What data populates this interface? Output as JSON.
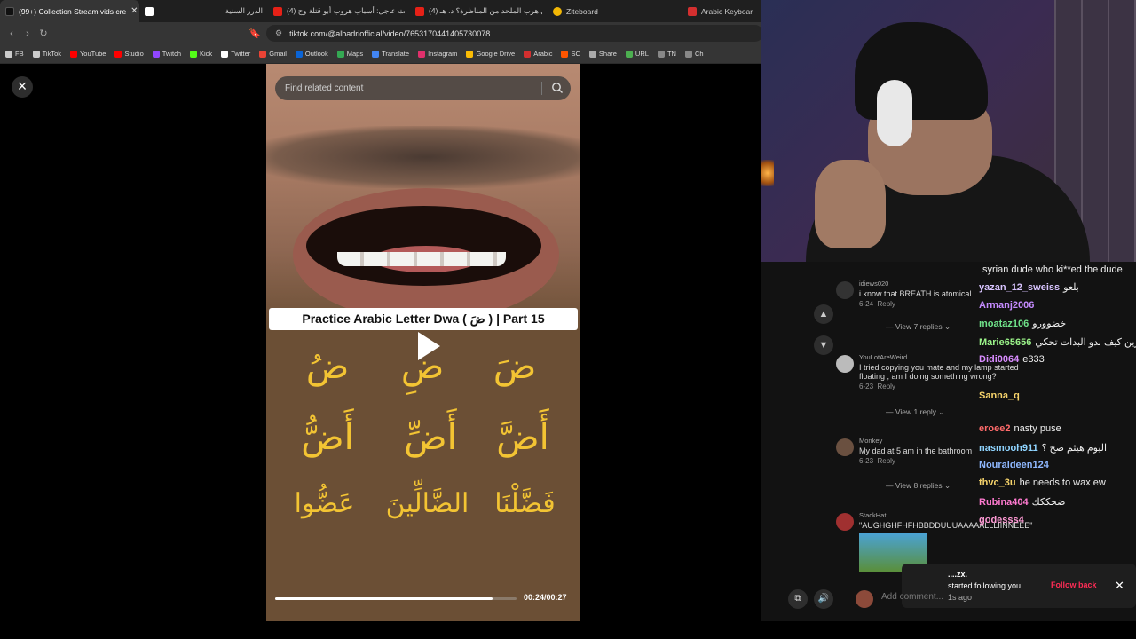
{
  "browser": {
    "tabs": [
      {
        "label": "(99+) Collection Stream vids cre",
        "color": "#111111",
        "active": true
      },
      {
        "label": "",
        "color": "#ffffff"
      },
      {
        "label": "الدرر السنية",
        "color": "#2a2a2a"
      },
      {
        "label": "(4) بث عاجل: أسباب هروب أبو قتلة وح",
        "color": "#e62117"
      },
      {
        "label": "(4) هل هرب الملحد من المناظرة؟ د. هـ",
        "color": "#e62117"
      },
      {
        "label": "Ziteboard",
        "color": "#f2b705"
      },
      {
        "label": "Arabic Keyboar",
        "color": "#d32f2f"
      }
    ],
    "url": "tiktok.com/@albadriofficial/video/7653170441405730078",
    "bookmarks": [
      {
        "label": "FB",
        "color": "#cccccc"
      },
      {
        "label": "TikTok",
        "color": "#cccccc"
      },
      {
        "label": "YouTube",
        "color": "#ff0000"
      },
      {
        "label": "Studio",
        "color": "#ff0000"
      },
      {
        "label": "Twitch",
        "color": "#9146ff"
      },
      {
        "label": "Kick",
        "color": "#53fc18"
      },
      {
        "label": "Twitter",
        "color": "#ffffff"
      },
      {
        "label": "Gmail",
        "color": "#ea4335"
      },
      {
        "label": "Outlook",
        "color": "#0a64d6"
      },
      {
        "label": "Maps",
        "color": "#34a853"
      },
      {
        "label": "Translate",
        "color": "#4285f4"
      },
      {
        "label": "Instagram",
        "color": "#e1306c"
      },
      {
        "label": "Google Drive",
        "color": "#fbbc04"
      },
      {
        "label": "Arabic",
        "color": "#d32f2f"
      },
      {
        "label": "SC",
        "color": "#ff5500"
      },
      {
        "label": "Share",
        "color": "#aaaaaa"
      },
      {
        "label": "URL",
        "color": "#4caf50"
      },
      {
        "label": "TN",
        "color": "#888888"
      },
      {
        "label": "Ch",
        "color": "#888888"
      }
    ]
  },
  "video": {
    "search_placeholder": "Find related content",
    "title": "Practice Arabic Letter Dwa ( ضَ ) | Part 15",
    "letters": [
      [
        "ضَ",
        "ضِ",
        "ضُ"
      ],
      [
        "أَضَّ",
        "أَضِّ",
        "أَضُّ"
      ],
      [
        "فَضَّلْنَا",
        "الضَّالِّينَ",
        "عَضُّوا"
      ]
    ],
    "time": "00:24/00:27",
    "progress": 0.9
  },
  "comments": [
    {
      "user": "idiews020",
      "text": "i know that BREATH is atomical",
      "date": "6-24",
      "reply": "Reply",
      "view_replies": "View 7 replies"
    },
    {
      "user": "YouLotAreWeird",
      "text": "I tried copying you mate and my lamp started floating , am I doing something wrong?",
      "date": "6-23",
      "reply": "Reply",
      "view_replies": "View 1 reply"
    },
    {
      "user": "Monkey",
      "text": "My dad at 5 am in the bathroom",
      "date": "6-23",
      "reply": "Reply",
      "view_replies": "View 8 replies"
    },
    {
      "user": "StackHat",
      "text": "\"AUGHGHFHFHBBDDUUUAAAAALLLIINNEEE\"",
      "date": "",
      "reply": "",
      "view_replies": ""
    }
  ],
  "chat": [
    {
      "user": "",
      "text": "syrian dude who ki**ed the dude",
      "color": "#e0e0e0"
    },
    {
      "user": "yazan_12_sweiss",
      "text": "بلعو",
      "color": "#d8c4ff"
    },
    {
      "user": "Armanj2006",
      "text": "",
      "color": "#c58bff"
    },
    {
      "user": "moataz106",
      "text": "خضوورو",
      "color": "#6fe38a"
    },
    {
      "user": "Marie65656",
      "text": "زين كيف بدو البدات تحكي",
      "color": "#9cf58a"
    },
    {
      "user": "Didi0064",
      "text": "e333",
      "color": "#d98cff"
    },
    {
      "user": "Sanna_q",
      "text": "",
      "color": "#f7d46b"
    },
    {
      "user": "eroee2",
      "text": "nasty puse",
      "color": "#ff6b6b"
    },
    {
      "user": "nasmooh911",
      "text": "اليوم هيثم صح ؟",
      "color": "#8fd4ff"
    },
    {
      "user": "Nouraldeen124",
      "text": "",
      "color": "#8fb8ff"
    },
    {
      "user": "thvc_3u",
      "text": "he needs to wax ew",
      "color": "#f7d46b"
    },
    {
      "user": "Rubina404",
      "text": "ضحككك",
      "color": "#ff7ad0"
    },
    {
      "user": "godesss4",
      "text": "",
      "color": "#ff9ad5"
    }
  ],
  "toast": {
    "name": "....zx.",
    "text": "started following you.",
    "time": "1s ago",
    "action": "Follow back"
  },
  "add_comment_placeholder": "Add comment..."
}
